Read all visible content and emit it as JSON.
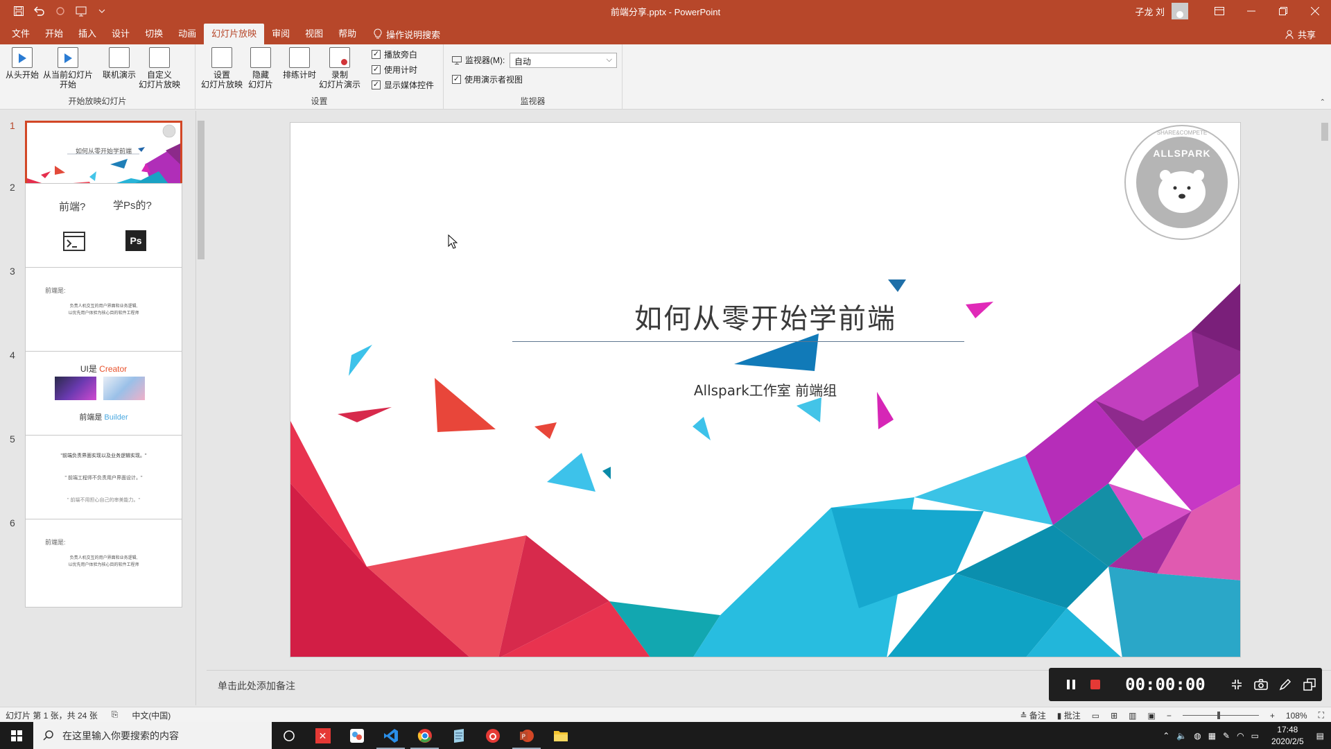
{
  "window": {
    "doc_title": "前端分享.pptx  -  PowerPoint",
    "user": "子龙 刘"
  },
  "tabs": [
    "文件",
    "开始",
    "插入",
    "设计",
    "切换",
    "动画",
    "幻灯片放映",
    "审阅",
    "视图",
    "帮助"
  ],
  "active_tab": "幻灯片放映",
  "tell_me": "操作说明搜索",
  "share": "共享",
  "ribbon": {
    "group_start": {
      "label": "开始放映幻灯片",
      "from_start": "从头开始",
      "from_current_1": "从当前幻灯片",
      "from_current_2": "开始",
      "online": "联机演示",
      "custom_1": "自定义",
      "custom_2": "幻灯片放映"
    },
    "group_setup": {
      "label": "设置",
      "setup_1": "设置",
      "setup_2": "幻灯片放映",
      "hide_1": "隐藏",
      "hide_2": "幻灯片",
      "rehearse": "排练计时",
      "record_1": "录制",
      "record_2": "幻灯片演示",
      "chk_narration": "播放旁白",
      "chk_timings": "使用计时",
      "chk_media": "显示媒体控件"
    },
    "group_monitors": {
      "label": "监视器",
      "monitor_label": "监视器(M):",
      "monitor_value": "自动",
      "presenter_view": "使用演示者视图"
    }
  },
  "thumbnails": {
    "numbers": [
      "1",
      "2",
      "3",
      "4",
      "5",
      "6"
    ],
    "t1_title": "如何从零开始学前端",
    "t2_a": "前端?",
    "t2_b": "学Ps的?",
    "t2_icon": "Ps",
    "t3_head": "前端是:",
    "t3_l1": "负责人机交互的用户界面和业务逻辑,",
    "t3_l2": "以优先用户体验为核心目的软件工程师",
    "t4_a": "UI是 ",
    "t4_a2": "Creator",
    "t4_b": "前端是 ",
    "t4_b2": "Builder",
    "t5_l1": "\"前端负责界面实现以及业务逻辑实现。\"",
    "t5_l2": "\" 前端工程师不负责用户界面设计。\"",
    "t5_l3": "\" 前端不用担心自己的审美能力。\"",
    "t6_head": "前端是:",
    "t6_l1": "负责人机交互的用户界面和业务逻辑,",
    "t6_l2": "以优先用户体验为核心目的软件工程师"
  },
  "slide": {
    "title": "如何从零开始学前端",
    "subtitle": "Allspark工作室 前端组",
    "logo_text": "ALLSPARK",
    "logo_ring": "SHARE&COMPETE"
  },
  "notes_placeholder": "单击此处添加备注",
  "recorder": {
    "time": "00:00:00"
  },
  "status": {
    "slide_info": "幻灯片 第 1 张，共 24 张",
    "language": "中文(中国)",
    "notes": "备注",
    "comments": "批注",
    "zoom": "108%"
  },
  "taskbar": {
    "search_placeholder": "在这里输入你要搜索的内容",
    "time": "17:48",
    "date": "2020/2/5"
  },
  "colors": {
    "accent": "#b7472a",
    "selected_border": "#d24726"
  }
}
